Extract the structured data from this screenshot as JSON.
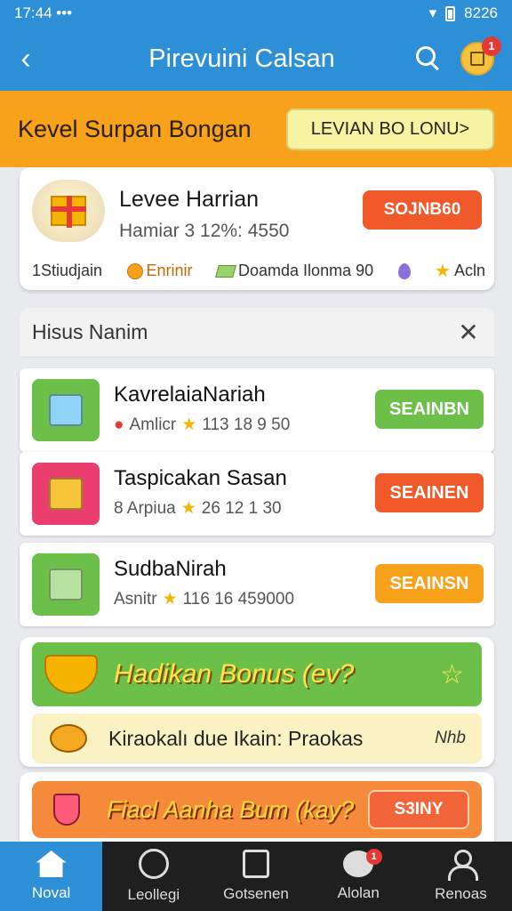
{
  "status_bar": {
    "time": "17:44",
    "dots": "•••",
    "right_text": "8226"
  },
  "app_bar": {
    "back_glyph": "‹",
    "title": "Pirevuini Calsan",
    "notification_count": "1"
  },
  "promo": {
    "text": "Kevel Surpan Bongan",
    "button_label": "LEVIAN BO LONU>"
  },
  "daily_card": {
    "title": "Levee Harrian",
    "subtitle": "Hamiar 3 12%: 4550",
    "button_label": "SOJNB60",
    "stats": [
      "1Stiudjain",
      "Enrinir",
      "Doamda Ilonma 90",
      "Acln"
    ]
  },
  "missions": {
    "header": "Hisus Nanim",
    "close_glyph": "✕",
    "items": [
      {
        "name": "KavrelaiaNariah",
        "meta_prefix": "Amlicr",
        "meta_value": "113 18 9 50",
        "button": "SEAINBN",
        "button_color": "#6cc04a",
        "icon_color": "#6cc04a",
        "icon_inner": "#8fd3f5"
      },
      {
        "name": "Taspicakan Sasan",
        "meta_prefix": "8 Arpiua",
        "meta_value": "26 12 1 30",
        "button": "SEAINEN",
        "button_color": "#f05a2a",
        "icon_color": "#ea3e6f",
        "icon_inner": "#f6c53a"
      },
      {
        "name": "SudbaNirah",
        "meta_prefix": "Asnitr",
        "meta_value": "116 16 459000",
        "button": "SEAINSN",
        "button_color": "#f8a11a",
        "icon_color": "#6cc04a",
        "icon_inner": "#b8e1a0"
      }
    ]
  },
  "bonus": {
    "title": "Hadikan Bonus (ev?",
    "star_glyph": "☆",
    "line": "Kiraokalı due Ikain: Praokas",
    "mark": "Nhb"
  },
  "feast": {
    "title": "Fiacl Aanha Bum (kay?",
    "button_label": "S3INY"
  },
  "nav": {
    "items": [
      {
        "label": "Noval"
      },
      {
        "label": "Leollegi"
      },
      {
        "label": "Gotsenen"
      },
      {
        "label": "Alolan",
        "badge": "1"
      },
      {
        "label": "Renoas"
      }
    ]
  },
  "colors": {
    "primary": "#2d8fd6",
    "promo": "#f8a11a",
    "green": "#6cc04a",
    "orange_red": "#f05a2a"
  }
}
